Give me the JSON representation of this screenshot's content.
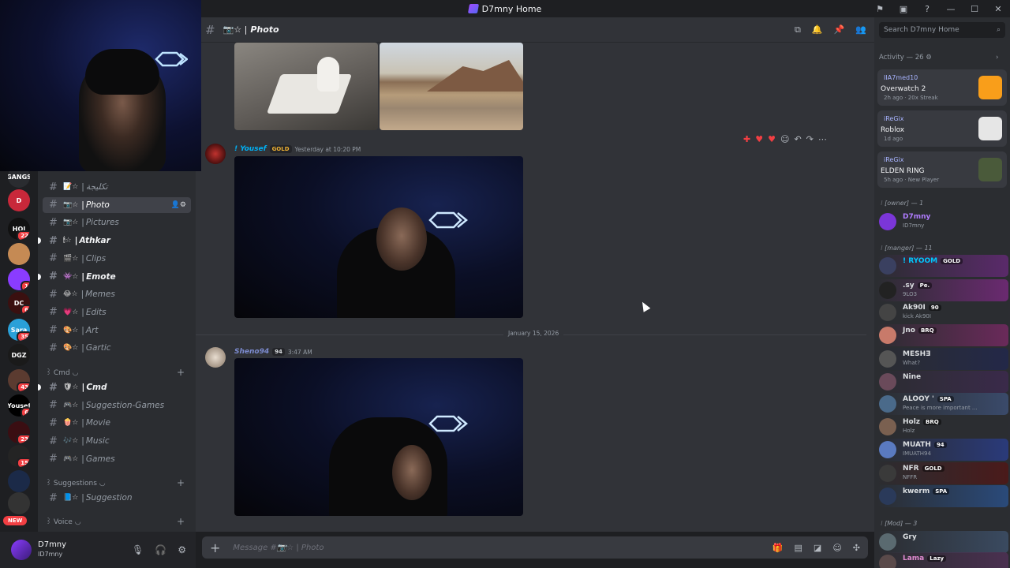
{
  "window": {
    "title": "D7mny Home",
    "controls": [
      "—",
      "☐",
      "✕"
    ]
  },
  "titlebar_icons": [
    "flag",
    "inbox",
    "?"
  ],
  "servers": [
    {
      "label": "GANGS",
      "badge": "",
      "color": "#2a2c30"
    },
    {
      "label": "D",
      "badge": "",
      "color": "#c8283a"
    },
    {
      "label": "HOI",
      "badge": "22",
      "color": "#111111"
    },
    {
      "label": "",
      "badge": "",
      "color": "#c58a54"
    },
    {
      "label": "",
      "badge": "1",
      "color": "#8a3cff"
    },
    {
      "label": "DC",
      "badge": "6",
      "color": "#3a1010"
    },
    {
      "label": "Sara",
      "badge": "35",
      "color": "#2aa0d8"
    },
    {
      "label": "DGZ",
      "badge": "",
      "color": "#1a1a1a"
    },
    {
      "label": "",
      "badge": "43",
      "color": "#5b3b30"
    },
    {
      "label": "Yousef",
      "badge": "6",
      "color": "#000000"
    },
    {
      "label": "",
      "badge": "23",
      "color": "#3a0e12"
    },
    {
      "label": "",
      "badge": "15",
      "color": "#242424"
    },
    {
      "label": "",
      "badge": "",
      "color": "#1b2a48"
    },
    {
      "label": "",
      "badge": "",
      "color": "#333333"
    }
  ],
  "new_label": "NEW",
  "channels": {
    "items": [
      {
        "emoji": "📝☆",
        "name": "تكليجة",
        "state": "normal"
      },
      {
        "emoji": "📷☆",
        "name": "Photo",
        "state": "active"
      },
      {
        "emoji": "📷☆",
        "name": "Pictures",
        "state": "normal"
      },
      {
        "emoji": "🕯☆",
        "name": "Athkar",
        "state": "bold"
      },
      {
        "emoji": "🎬☆",
        "name": "Clips",
        "state": "normal"
      },
      {
        "emoji": "👾☆",
        "name": "Emote",
        "state": "bold"
      },
      {
        "emoji": "😂☆",
        "name": "Memes",
        "state": "normal"
      },
      {
        "emoji": "💗☆",
        "name": "Edits",
        "state": "normal"
      },
      {
        "emoji": "🎨☆",
        "name": "Art",
        "state": "normal"
      },
      {
        "emoji": "🎨☆",
        "name": "Gartic",
        "state": "normal"
      }
    ],
    "cmd_category": "꒱ Cmd ◡",
    "cmd_items": [
      {
        "emoji": "🛡☆",
        "name": "Cmd",
        "state": "bold"
      },
      {
        "emoji": "🎮☆",
        "name": "Suggestion-Games",
        "state": "normal"
      },
      {
        "emoji": "🍿☆",
        "name": "Movie",
        "state": "normal"
      },
      {
        "emoji": "🎶☆",
        "name": "Music",
        "state": "normal"
      },
      {
        "emoji": "🎮☆",
        "name": "Games",
        "state": "normal"
      }
    ],
    "suggestions_category": "꒱ Suggestions ◡",
    "suggestion_items": [
      {
        "emoji": "📘☆",
        "name": "Suggestion",
        "state": "normal"
      }
    ],
    "voice_category": "꒱ Voice ◡"
  },
  "user": {
    "name": "D7mny",
    "tag": "ID7mny"
  },
  "header": {
    "title": "Photo",
    "prefix": "📷☆ |"
  },
  "messages": [
    {
      "author": "! Yousef",
      "badge": "GOLD",
      "time": "Yesterday at 10:20 PM",
      "color": "#00b0f4"
    },
    {
      "author": "Sheno94",
      "badge": "94",
      "time": "3:47 AM",
      "color": "#7c8bd0"
    }
  ],
  "date_divider": "January 15, 2026",
  "composer": {
    "placeholder": "Message #📷☆ | Photo"
  },
  "search": {
    "placeholder": "Search D7mny Home"
  },
  "activity": {
    "heading": "Activity — 26",
    "cards": [
      {
        "user": "IIA7med10",
        "game": "Overwatch 2",
        "meta": "2h ago  ·  20x Streak",
        "logo_color": "#f99e1a"
      },
      {
        "user": "iReGix",
        "game": "Roblox",
        "meta": "1d ago",
        "logo_color": "#e6e6e6"
      },
      {
        "user": "iReGix",
        "game": "ELDEN RING",
        "meta": "5h ago  ·  New Player",
        "logo_color": "#4a5a3a"
      }
    ]
  },
  "roles": {
    "owner": "⁝ [owner] — 1",
    "manger": "⁝ [manger] — 11",
    "mod": "⁝ [Mod] — 3"
  },
  "owner_members": [
    {
      "name": "D7mny",
      "sub": "ID7mny",
      "tag": "",
      "color": "#b07cff",
      "bg": "transparent",
      "av": "#7b36d8"
    }
  ],
  "manger_members": [
    {
      "name": "! RYOOM",
      "sub": "",
      "tag": "GOLD",
      "color": "#00c8ff",
      "bg": "#5a2a6a",
      "av": "#3a4060"
    },
    {
      "name": ".sy",
      "sub": "9LO3",
      "tag": "Pe.",
      "color": "#dbdee1",
      "bg": "#6a2a70",
      "av": "#222222"
    },
    {
      "name": "Ak90I",
      "sub": "kick Ak90I",
      "tag": "90",
      "color": "#dbdee1",
      "bg": "transparent",
      "av": "#444444"
    },
    {
      "name": "Jno",
      "sub": "",
      "tag": "BRQ",
      "color": "#dbdee1",
      "bg": "#6a2a5a",
      "av": "#c87a6a"
    },
    {
      "name": "MESHƎ",
      "sub": "What?",
      "tag": "",
      "color": "#dbdee1",
      "bg": "#232848",
      "av": "#555555"
    },
    {
      "name": "Nine",
      "sub": "",
      "tag": "",
      "color": "#dbdee1",
      "bg": "#3a2a4a",
      "av": "#6a4a5a"
    },
    {
      "name": "ALOOY '",
      "sub": "Peace is more important ...",
      "tag": "SPA",
      "color": "#dbdee1",
      "bg": "#3a4a6a",
      "av": "#4a6a8a"
    },
    {
      "name": "Holz",
      "sub": "Holz",
      "tag": "BRQ",
      "color": "#dbdee1",
      "bg": "transparent",
      "av": "#7a6050"
    },
    {
      "name": "MUATH",
      "sub": "IMUATH94",
      "tag": "94",
      "color": "#dbdee1",
      "bg": "#2a3a7a",
      "av": "#5a7ac0"
    },
    {
      "name": "NFR",
      "sub": "NFFR",
      "tag": "GOLD",
      "color": "#dbdee1",
      "bg": "#4a1a1a",
      "av": "#3a3a3a"
    },
    {
      "name": "kwerm",
      "sub": "",
      "tag": "SPA",
      "color": "#dbdee1",
      "bg": "#2a4a7a",
      "av": "#2a3a5a"
    }
  ],
  "mod_members": [
    {
      "name": "Gry",
      "sub": "",
      "tag": "",
      "color": "#dbdee1",
      "bg": "#3a4a60",
      "av": "#5a6a70"
    },
    {
      "name": "Lama",
      "sub": "",
      "tag": "Lazy",
      "color": "#e08ad0",
      "bg": "#4a3050",
      "av": "#5a4a4a"
    }
  ]
}
